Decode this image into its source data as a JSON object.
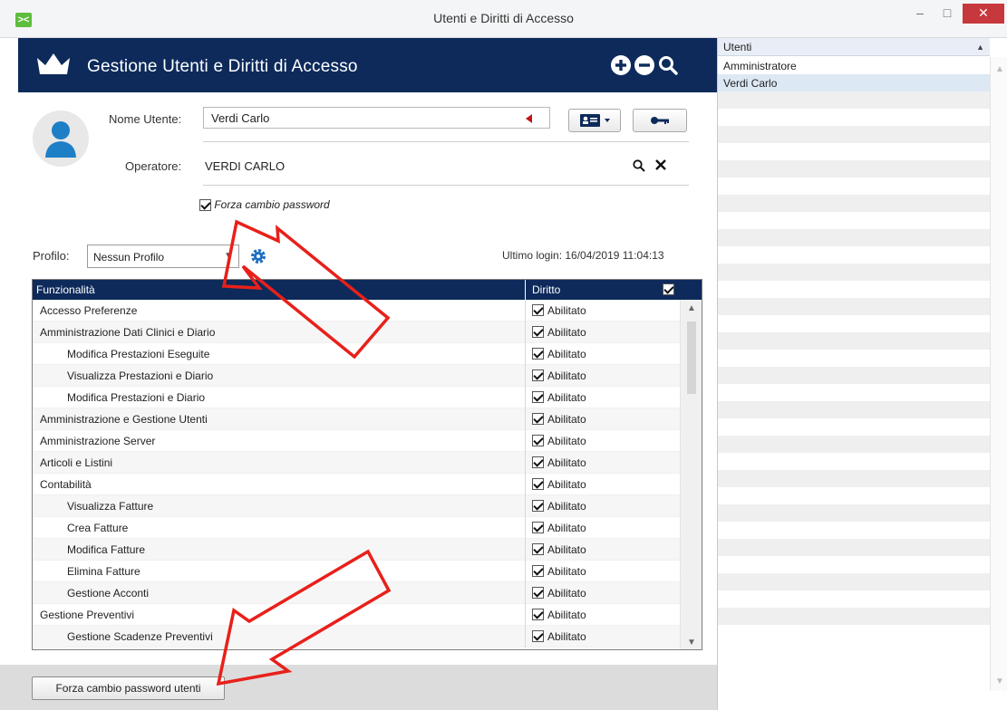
{
  "window": {
    "title": "Utenti e Diritti di Accesso",
    "app_icon": "><",
    "min_label": "–",
    "max_label": "□",
    "close_label": "✕"
  },
  "header": {
    "title": "Gestione Utenti e Diritti di Accesso",
    "icons": [
      "crown-icon",
      "add-icon",
      "remove-icon",
      "search-icon"
    ],
    "background": "#0d2a5b"
  },
  "form": {
    "nome_label": "Nome Utente:",
    "nome_value": "Verdi Carlo",
    "operatore_label": "Operatore:",
    "operatore_value": "VERDI CARLO",
    "forza_label": "Forza cambio password",
    "forza_checked": true
  },
  "profilo": {
    "label": "Profilo:",
    "selected": "Nessun Profilo",
    "last_login": "Ultimo login: 16/04/2019 11:04:13"
  },
  "table": {
    "col_funzionalita": "Funzionalità",
    "col_diritto": "Diritto",
    "rows": [
      {
        "name": "Accesso Preferenze",
        "indent": false,
        "diritto": "Abilitato"
      },
      {
        "name": "Amministrazione Dati Clinici e Diario",
        "indent": false,
        "diritto": "Abilitato"
      },
      {
        "name": "Modifica Prestazioni Eseguite",
        "indent": true,
        "diritto": "Abilitato"
      },
      {
        "name": "Visualizza Prestazioni e Diario",
        "indent": true,
        "diritto": "Abilitato"
      },
      {
        "name": "Modifica Prestazioni e Diario",
        "indent": true,
        "diritto": "Abilitato"
      },
      {
        "name": "Amministrazione e Gestione Utenti",
        "indent": false,
        "diritto": "Abilitato"
      },
      {
        "name": "Amministrazione Server",
        "indent": false,
        "diritto": "Abilitato"
      },
      {
        "name": "Articoli e Listini",
        "indent": false,
        "diritto": "Abilitato"
      },
      {
        "name": "Contabilità",
        "indent": false,
        "diritto": "Abilitato"
      },
      {
        "name": "Visualizza Fatture",
        "indent": true,
        "diritto": "Abilitato"
      },
      {
        "name": "Crea Fatture",
        "indent": true,
        "diritto": "Abilitato"
      },
      {
        "name": "Modifica Fatture",
        "indent": true,
        "diritto": "Abilitato"
      },
      {
        "name": "Elimina Fatture",
        "indent": true,
        "diritto": "Abilitato"
      },
      {
        "name": "Gestione Acconti",
        "indent": true,
        "diritto": "Abilitato"
      },
      {
        "name": "Gestione Preventivi",
        "indent": false,
        "diritto": "Abilitato"
      },
      {
        "name": "Gestione Scadenze Preventivi",
        "indent": true,
        "diritto": "Abilitato"
      }
    ]
  },
  "bottom": {
    "button_label": "Forza cambio password utenti"
  },
  "users": {
    "header": "Utenti",
    "items": [
      {
        "name": "Amministratore",
        "selected": false
      },
      {
        "name": "Verdi Carlo",
        "selected": true
      }
    ]
  },
  "colors": {
    "accent": "#0d2a5b",
    "annotation": "#e8201a",
    "close": "#c7383d"
  }
}
